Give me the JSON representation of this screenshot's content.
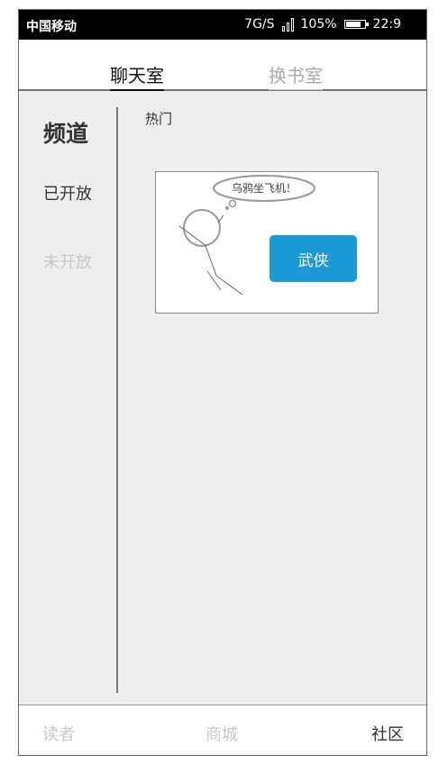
{
  "status_bar": {
    "carrier": "中国移动",
    "network_speed": "7G/S",
    "battery_percent": "105%",
    "time": "22:9"
  },
  "tabs": [
    {
      "label": "聊天室",
      "active": true
    },
    {
      "label": "换书室",
      "active": false
    }
  ],
  "sidebar": {
    "title": "频道",
    "items": [
      {
        "label": "已开放",
        "enabled": true
      },
      {
        "label": "未开放",
        "enabled": false
      }
    ]
  },
  "content": {
    "section_label": "热门",
    "card": {
      "bubble_text": "乌鸦坐飞机！",
      "button_label": "武侠",
      "button_color": "#1b9ad6"
    }
  },
  "bottom_nav": [
    {
      "label": "读者",
      "active": false
    },
    {
      "label": "商城",
      "active": false
    },
    {
      "label": "社区",
      "active": true
    }
  ]
}
